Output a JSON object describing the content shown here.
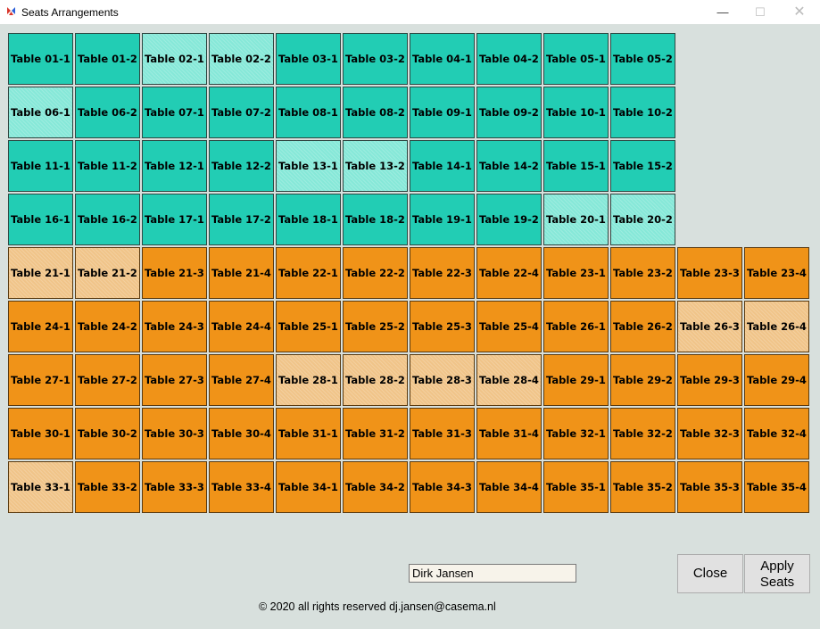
{
  "window": {
    "title": "Seats Arrangements",
    "minimize_glyph": "—",
    "maximize_glyph": "☐",
    "close_glyph": "✕"
  },
  "seat_colors": {
    "teal": "#22cdb4",
    "teal-light": "#86e8d8",
    "orange": "#f09318",
    "orange-light": "#f0c489"
  },
  "seat_rows": [
    {
      "color": "teal",
      "seats": [
        {
          "label": "Table 01-1"
        },
        {
          "label": "Table 01-2"
        },
        {
          "label": "Table 02-1",
          "light": true
        },
        {
          "label": "Table 02-2",
          "light": true
        },
        {
          "label": "Table 03-1"
        },
        {
          "label": "Table 03-2"
        },
        {
          "label": "Table 04-1"
        },
        {
          "label": "Table 04-2"
        },
        {
          "label": "Table 05-1"
        },
        {
          "label": "Table 05-2"
        }
      ]
    },
    {
      "color": "teal",
      "seats": [
        {
          "label": "Table 06-1",
          "light": true
        },
        {
          "label": "Table 06-2"
        },
        {
          "label": "Table 07-1"
        },
        {
          "label": "Table 07-2"
        },
        {
          "label": "Table 08-1"
        },
        {
          "label": "Table 08-2"
        },
        {
          "label": "Table 09-1"
        },
        {
          "label": "Table 09-2"
        },
        {
          "label": "Table 10-1"
        },
        {
          "label": "Table 10-2"
        }
      ]
    },
    {
      "color": "teal",
      "seats": [
        {
          "label": "Table 11-1"
        },
        {
          "label": "Table 11-2"
        },
        {
          "label": "Table 12-1"
        },
        {
          "label": "Table 12-2"
        },
        {
          "label": "Table 13-1",
          "light": true
        },
        {
          "label": "Table 13-2",
          "light": true
        },
        {
          "label": "Table 14-1"
        },
        {
          "label": "Table 14-2"
        },
        {
          "label": "Table 15-1"
        },
        {
          "label": "Table 15-2"
        }
      ]
    },
    {
      "color": "teal",
      "seats": [
        {
          "label": "Table 16-1"
        },
        {
          "label": "Table 16-2"
        },
        {
          "label": "Table 17-1"
        },
        {
          "label": "Table 17-2"
        },
        {
          "label": "Table 18-1"
        },
        {
          "label": "Table 18-2"
        },
        {
          "label": "Table 19-1"
        },
        {
          "label": "Table 19-2"
        },
        {
          "label": "Table 20-1",
          "light": true
        },
        {
          "label": "Table 20-2",
          "light": true
        }
      ]
    },
    {
      "color": "orange",
      "seats": [
        {
          "label": "Table 21-1",
          "light": true
        },
        {
          "label": "Table 21-2",
          "light": true
        },
        {
          "label": "Table 21-3"
        },
        {
          "label": "Table 21-4"
        },
        {
          "label": "Table 22-1"
        },
        {
          "label": "Table 22-2"
        },
        {
          "label": "Table 22-3"
        },
        {
          "label": "Table 22-4"
        },
        {
          "label": "Table 23-1"
        },
        {
          "label": "Table 23-2"
        },
        {
          "label": "Table 23-3"
        },
        {
          "label": "Table 23-4"
        }
      ]
    },
    {
      "color": "orange",
      "seats": [
        {
          "label": "Table 24-1"
        },
        {
          "label": "Table 24-2"
        },
        {
          "label": "Table 24-3"
        },
        {
          "label": "Table 24-4"
        },
        {
          "label": "Table 25-1"
        },
        {
          "label": "Table 25-2"
        },
        {
          "label": "Table 25-3"
        },
        {
          "label": "Table 25-4"
        },
        {
          "label": "Table 26-1"
        },
        {
          "label": "Table 26-2"
        },
        {
          "label": "Table 26-3",
          "light": true
        },
        {
          "label": "Table 26-4",
          "light": true
        }
      ]
    },
    {
      "color": "orange",
      "seats": [
        {
          "label": "Table 27-1"
        },
        {
          "label": "Table 27-2"
        },
        {
          "label": "Table 27-3"
        },
        {
          "label": "Table 27-4"
        },
        {
          "label": "Table 28-1",
          "light": true
        },
        {
          "label": "Table 28-2",
          "light": true
        },
        {
          "label": "Table 28-3",
          "light": true
        },
        {
          "label": "Table 28-4",
          "light": true
        },
        {
          "label": "Table 29-1"
        },
        {
          "label": "Table 29-2"
        },
        {
          "label": "Table 29-3"
        },
        {
          "label": "Table 29-4"
        }
      ]
    },
    {
      "color": "orange",
      "seats": [
        {
          "label": "Table 30-1"
        },
        {
          "label": "Table 30-2"
        },
        {
          "label": "Table 30-3"
        },
        {
          "label": "Table 30-4"
        },
        {
          "label": "Table 31-1"
        },
        {
          "label": "Table 31-2"
        },
        {
          "label": "Table 31-3"
        },
        {
          "label": "Table 31-4"
        },
        {
          "label": "Table 32-1"
        },
        {
          "label": "Table 32-2"
        },
        {
          "label": "Table 32-3"
        },
        {
          "label": "Table 32-4"
        }
      ]
    },
    {
      "color": "orange",
      "seats": [
        {
          "label": "Table 33-1",
          "light": true
        },
        {
          "label": "Table 33-2"
        },
        {
          "label": "Table 33-3"
        },
        {
          "label": "Table 33-4"
        },
        {
          "label": "Table 34-1"
        },
        {
          "label": "Table 34-2"
        },
        {
          "label": "Table 34-3"
        },
        {
          "label": "Table 34-4"
        },
        {
          "label": "Table 35-1"
        },
        {
          "label": "Table 35-2"
        },
        {
          "label": "Table 35-3"
        },
        {
          "label": "Table 35-4"
        }
      ]
    }
  ],
  "guest_name": {
    "value": "Dirk Jansen"
  },
  "buttons": {
    "close_label": "Close",
    "apply_line1": "Apply",
    "apply_line2": "Seats"
  },
  "footer": {
    "copyright": "© 2020 all rights reserved dj.jansen@casema.nl"
  }
}
